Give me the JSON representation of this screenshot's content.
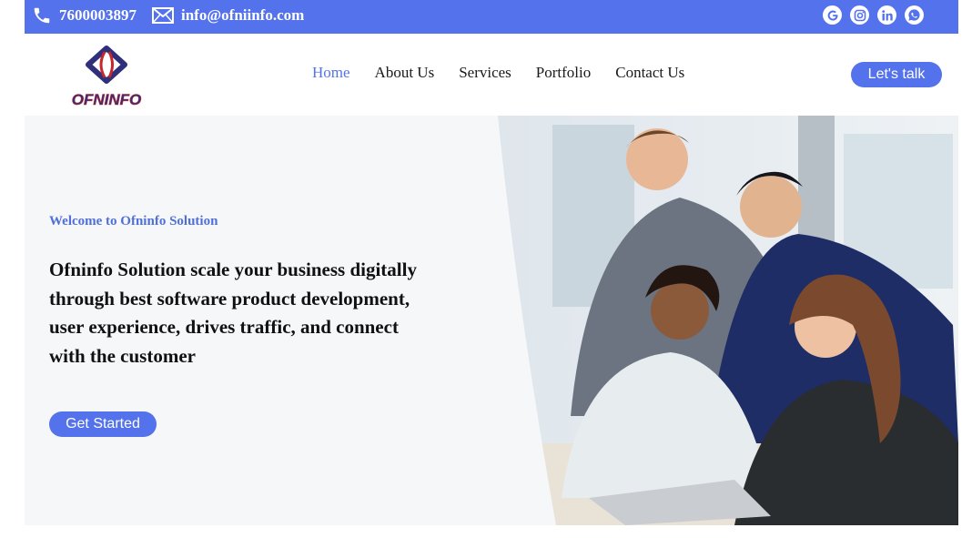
{
  "topbar": {
    "phone": "7600003897",
    "email": "info@ofniinfo.com",
    "background_color": "#5472ec",
    "socials": [
      {
        "name": "google-icon",
        "label": "G"
      },
      {
        "name": "instagram-icon",
        "label": ""
      },
      {
        "name": "linkedin-icon",
        "label": "in"
      },
      {
        "name": "whatsapp-icon",
        "label": ""
      }
    ]
  },
  "logo": {
    "text": "OFNINFO"
  },
  "nav": {
    "items": [
      "Home",
      "About Us",
      "Services",
      "Portfolio",
      "Contact Us"
    ],
    "active": "Home",
    "cta_label": "Let's talk"
  },
  "hero": {
    "welcome": "Welcome to Ofninfo Solution",
    "headline": "Ofninfo Solution scale your business digitally through best software product development, user experience, drives traffic, and connect with the customer",
    "button_label": "Get Started",
    "image": "team-of-professionals-photo"
  },
  "colors": {
    "accent": "#5472ec",
    "hero_bg": "#f6f7f9"
  }
}
